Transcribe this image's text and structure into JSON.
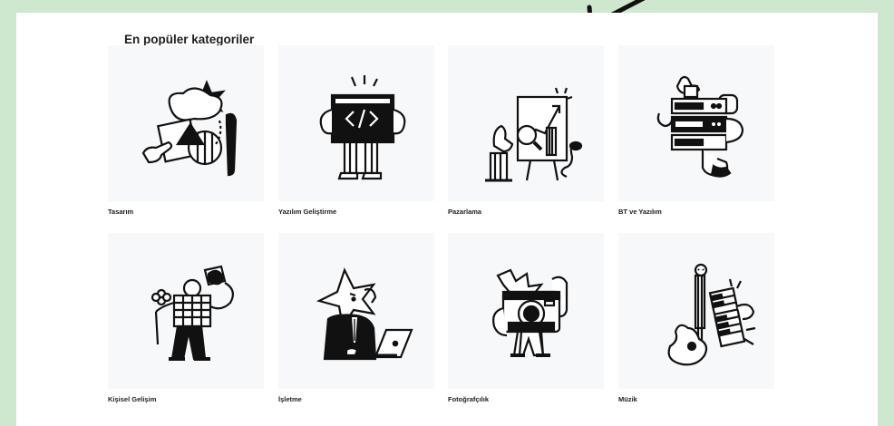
{
  "section": {
    "title": "En popüler kategoriler"
  },
  "categories": [
    {
      "label": "Tasarım",
      "icon": "design-illustration-icon"
    },
    {
      "label": "Yazılım Geliştirme",
      "icon": "code-window-icon"
    },
    {
      "label": "Pazarlama",
      "icon": "analytics-chart-icon"
    },
    {
      "label": "BT ve Yazılım",
      "icon": "server-rack-icon"
    },
    {
      "label": "Kişisel Gelişim",
      "icon": "megaphone-person-icon"
    },
    {
      "label": "İşletme",
      "icon": "business-laptop-icon"
    },
    {
      "label": "Fotoğrafçılık",
      "icon": "camera-icon"
    },
    {
      "label": "Müzik",
      "icon": "guitar-keyboard-icon"
    }
  ],
  "colors": {
    "background": "#cde8cf",
    "panel": "#ffffff",
    "tile": "#f7f8fa",
    "text": "#1c1d1f"
  }
}
